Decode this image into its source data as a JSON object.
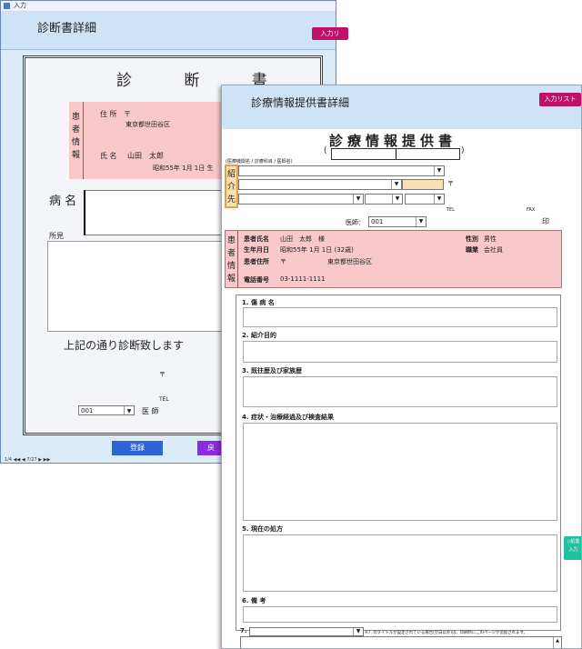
{
  "back_window": {
    "titlebar": "入力",
    "header_title": "診断書詳細",
    "list_button": "入力リ",
    "doc_title": "診 断 書",
    "patient_box_label": "患者情報",
    "address_label": "住 所",
    "postal_mark": "〒",
    "address_value": "東京都世田谷区",
    "name_label": "氏 名",
    "name_value": "山田　太郎",
    "birth_value": "昭和55年 1月 1日 生",
    "disease_label": "病 名",
    "finding_label": "所見",
    "statement": "上記の通り診断致します",
    "clinic_postal": "〒",
    "clinic_tel": "TEL",
    "doctor_select": "001",
    "doctor_label": "医 師",
    "register_button": "登録",
    "other_button": "戻",
    "status_bar": "1/4  ◀◀  ◀  7/27  ▶  ▶▶"
  },
  "front_window": {
    "header_title": "診療情報提供書詳細",
    "list_button": "入力リスト",
    "doc_title": "診療情報提供書",
    "paren_open": "(",
    "paren_close": ")",
    "referral_caption": "(医療機関名 / 診療科目 / 医師名)",
    "referral_label": "紹介先",
    "postal_mark": "〒",
    "tel_label": "TEL",
    "fax_label": "FAX",
    "doctor_label": "医師：",
    "doctor_select": "001",
    "seal": "印",
    "patient_label": "患者情報",
    "patient": {
      "name_label": "患者氏名",
      "name_value": "山田　太郎　様",
      "sex_label": "性別",
      "sex_value": "男性",
      "birth_label": "生年月日",
      "birth_value": "昭和55年 1月 1日 (32歳)",
      "job_label": "職業",
      "job_value": "会社員",
      "address_label": "患者住所",
      "postal_mark": "〒",
      "address_value": "東京都世田谷区",
      "phone_label": "電話番号",
      "phone_value": "03-1111-1111"
    },
    "sections": [
      "1. 傷 病 名",
      "2. 紹介目的",
      "3. 既往歴及び家族歴",
      "4. 症状・治療経過及び検査結果",
      "5. 現在の処方",
      "6. 備 考"
    ],
    "copy_button": "◇処置\n入力",
    "item7_label": "7.",
    "item7_note": "※7. のタイトルが設定されている場合(空白以外)は、印刷時にこのページが追加されます。"
  },
  "colors": {
    "patient_bg": "#f9c8c8",
    "referral_bg": "#f9e0b0",
    "header_bg": "#cfe3f7",
    "list_button": "#c0106a",
    "register_button": "#2f63d8",
    "copy_button": "#20c0a0"
  }
}
